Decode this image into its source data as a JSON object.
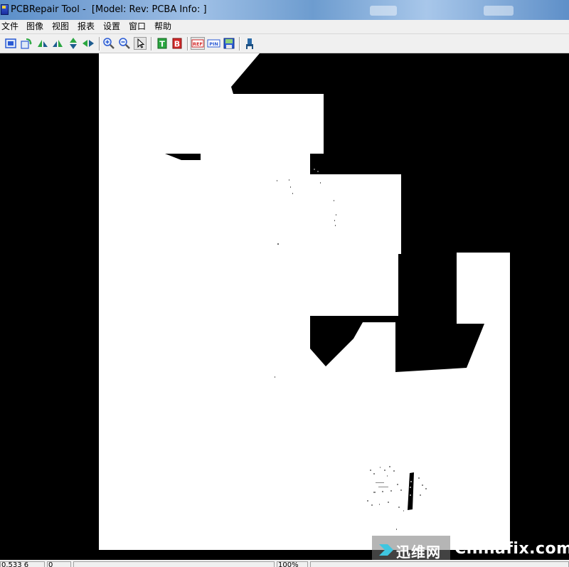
{
  "window": {
    "title": "PCBRepair Tool -  [Model: Rev: PCBA Info: ]"
  },
  "menu": {
    "items": [
      "文件",
      "图像",
      "视图",
      "报表",
      "设置",
      "窗口",
      "帮助"
    ]
  },
  "toolbar": {
    "buttons": [
      {
        "icon": "fit-window-icon"
      },
      {
        "icon": "rotate-icon"
      },
      {
        "icon": "flip-left-icon"
      },
      {
        "icon": "flip-right-icon"
      },
      {
        "icon": "flip-vertical-icon"
      },
      {
        "icon": "flip-horizontal-icon"
      },
      {
        "icon": "zoom-in-icon"
      },
      {
        "icon": "zoom-out-icon"
      },
      {
        "icon": "pointer-icon"
      },
      {
        "icon": "top-side-icon",
        "label": "T"
      },
      {
        "icon": "bottom-side-icon",
        "label": "B"
      },
      {
        "icon": "ref-icon",
        "label": "REF"
      },
      {
        "icon": "pin-icon",
        "label": "PIN"
      },
      {
        "icon": "save-image-icon"
      },
      {
        "icon": "probe-icon"
      }
    ]
  },
  "colors": {
    "board": "#ffffff",
    "background": "#000000",
    "tb_green": "#2aa640",
    "tb_red": "#d42a2a",
    "tb_blue": "#2a5ad4"
  },
  "statusbar": {
    "coords": "0.533 6",
    "layer": "0",
    "zoom": "100%"
  },
  "watermark": {
    "cn": "迅维网",
    "en": "Chinafix.com"
  }
}
